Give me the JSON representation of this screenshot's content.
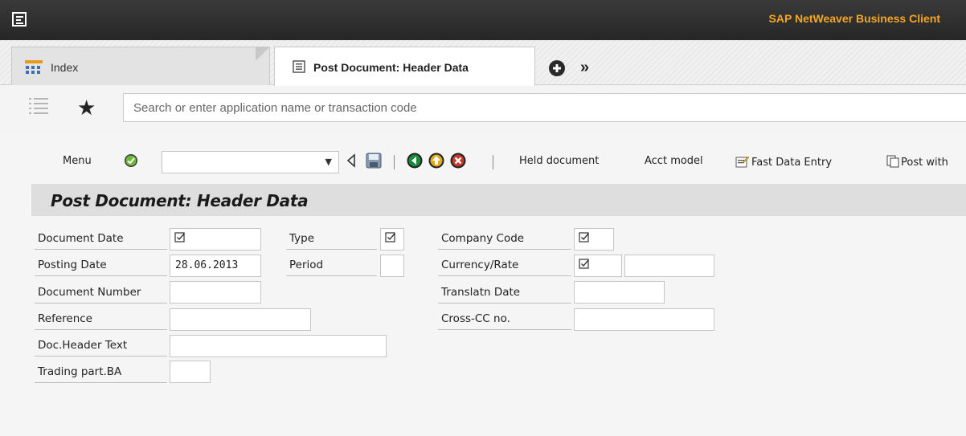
{
  "window": {
    "product": "SAP NetWeaver Business Client"
  },
  "tabs": [
    {
      "label": "Index"
    },
    {
      "label": "Post Document: Header Data"
    }
  ],
  "search": {
    "placeholder": "Search or enter application name or transaction code"
  },
  "toolbar": {
    "menu": "Menu",
    "held": "Held document",
    "acct": "Acct model",
    "fast": "Fast Data Entry",
    "post": "Post with"
  },
  "page": {
    "title": "Post Document: Header Data"
  },
  "form": {
    "document_date": {
      "label": "Document Date"
    },
    "posting_date": {
      "label": "Posting Date",
      "value": "28.06.2013"
    },
    "document_number": {
      "label": "Document Number"
    },
    "reference": {
      "label": "Reference"
    },
    "doc_header_text": {
      "label": "Doc.Header Text"
    },
    "trading_part": {
      "label": "Trading part.BA"
    },
    "type": {
      "label": "Type"
    },
    "period": {
      "label": "Period"
    },
    "company_code": {
      "label": "Company Code"
    },
    "currency_rate": {
      "label": "Currency/Rate"
    },
    "translatn_date": {
      "label": "Translatn Date"
    },
    "cross_cc": {
      "label": "Cross-CC no."
    }
  },
  "colors": {
    "brand": "#f5a623",
    "titlebar": "#2e2e2e"
  },
  "icons": [
    "menu-icon",
    "index-icon",
    "document-icon",
    "add-tab-icon",
    "more-tabs-icon",
    "list-icon",
    "favorites-star-icon",
    "confirm-icon",
    "back-triangle-icon",
    "save-icon",
    "back-icon",
    "exit-icon",
    "cancel-icon",
    "fast-entry-icon",
    "post-icon",
    "required-check-icon"
  ]
}
